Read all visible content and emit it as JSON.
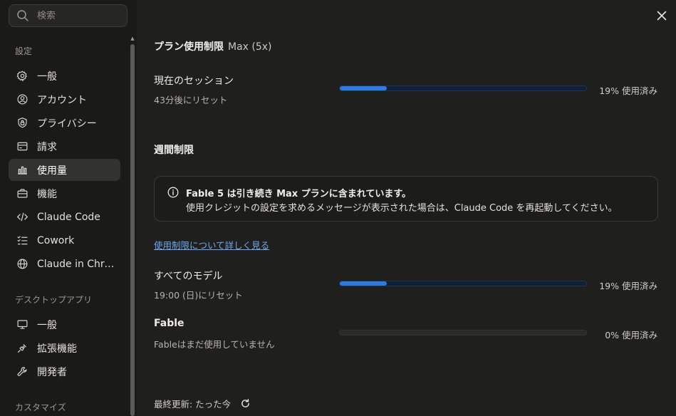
{
  "search": {
    "placeholder": "検索"
  },
  "sidebar": {
    "settings_label": "設定",
    "settings_items": [
      {
        "label": "一般",
        "icon": "gear-icon"
      },
      {
        "label": "アカウント",
        "icon": "user-circle-icon"
      },
      {
        "label": "プライバシー",
        "icon": "shield-lock-icon"
      },
      {
        "label": "請求",
        "icon": "credit-card-icon"
      },
      {
        "label": "使用量",
        "icon": "bar-chart-icon",
        "active": true
      },
      {
        "label": "機能",
        "icon": "briefcase-icon"
      },
      {
        "label": "Claude Code",
        "icon": "code-icon"
      },
      {
        "label": "Cowork",
        "icon": "checklist-icon"
      },
      {
        "label": "Claude in Chrome",
        "icon": "globe-icon"
      }
    ],
    "desktop_label": "デスクトップアプリ",
    "desktop_items": [
      {
        "label": "一般",
        "icon": "monitor-icon"
      },
      {
        "label": "拡張機能",
        "icon": "plug-icon"
      },
      {
        "label": "開発者",
        "icon": "wrench-icon"
      }
    ],
    "customize_label": "カスタマイズ"
  },
  "main": {
    "plan_heading": "プラン使用制限",
    "plan_name": "Max (5x)",
    "session": {
      "title": "現在のセッション",
      "reset": "43分後にリセット",
      "percent": 19,
      "percent_text": "19% 使用済み"
    },
    "weekly_heading": "週間制限",
    "notice": {
      "line1": "Fable 5 は引き続き Max プランに含まれています。",
      "line2": "使用クレジットの設定を求めるメッセージが表示された場合は、Claude Code を再起動してください。"
    },
    "learn_more": "使用制限について詳しく見る",
    "all_models": {
      "title": "すべてのモデル",
      "reset": "19:00 (日)にリセット",
      "percent": 19,
      "percent_text": "19% 使用済み"
    },
    "fable": {
      "title": "Fable",
      "reset": "Fableはまだ使用していません",
      "percent": 0,
      "percent_text": "0% 使用済み"
    },
    "last_updated": "最終更新: たった今"
  },
  "colors": {
    "accent": "#2f7be0",
    "link": "#6ea8f2",
    "background": "#1f1f1e",
    "sidebar": "#1a1a19"
  }
}
